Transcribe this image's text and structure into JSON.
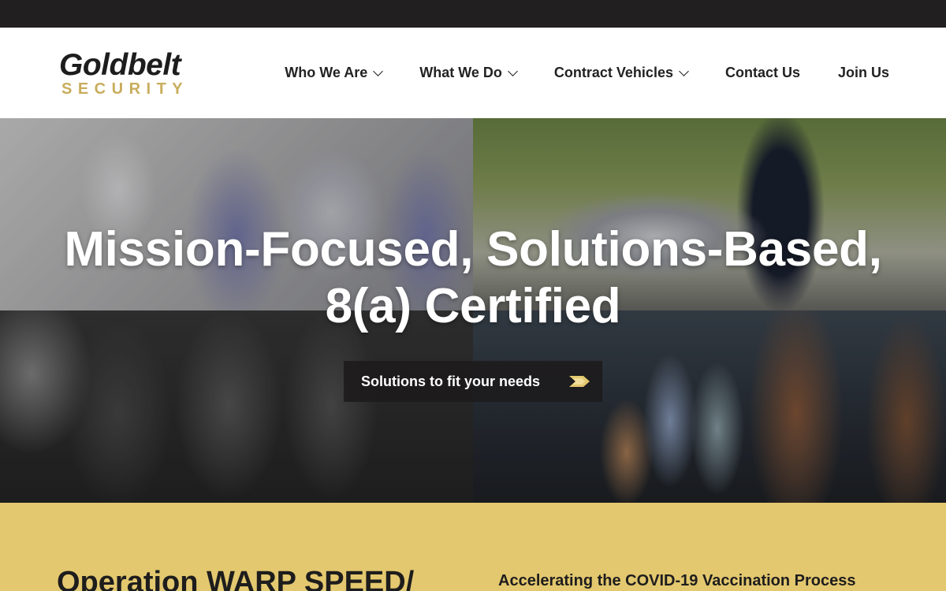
{
  "brand": {
    "name": "Goldbelt",
    "sub": "SECURITY",
    "colors": {
      "gold": "#e3c86f",
      "logo_gold": "#c9ad5d",
      "dark": "#211f20"
    }
  },
  "nav": {
    "items": [
      {
        "label": "Who We Are",
        "has_dropdown": true
      },
      {
        "label": "What We Do",
        "has_dropdown": true
      },
      {
        "label": "Contract Vehicles",
        "has_dropdown": true
      },
      {
        "label": "Contact Us",
        "has_dropdown": false
      },
      {
        "label": "Join Us",
        "has_dropdown": false
      }
    ]
  },
  "hero": {
    "title_line1": "Mission-Focused, Solutions-Based,",
    "title_line2": "8(a) Certified",
    "cta_label": "Solutions to fit your needs",
    "cta_icon": "arrow-right-icon"
  },
  "section": {
    "heading": "Operation WARP SPEED/",
    "subheading": "Accelerating the COVID-19 Vaccination Process"
  }
}
